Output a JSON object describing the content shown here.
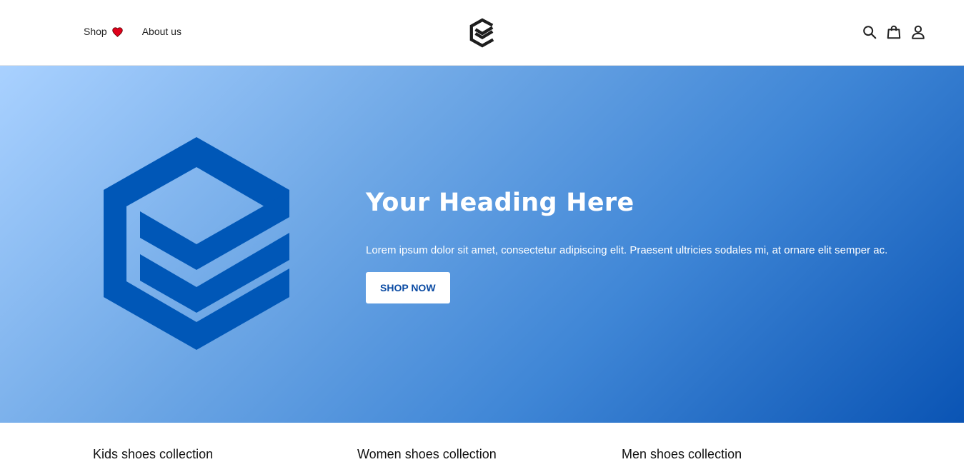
{
  "header": {
    "nav_left": [
      {
        "label": "Shop",
        "icon": "heart-icon"
      },
      {
        "label": "About us"
      }
    ],
    "logo": "brand-logo-icon",
    "nav_right_icons": [
      "search-icon",
      "shopping-bag-icon",
      "user-icon"
    ]
  },
  "hero": {
    "heading": "Your Heading Here",
    "text": "Lorem ipsum dolor sit amet, consectetur adipiscing elit. Praesent ultricies sodales mi, at ornare elit semper ac.",
    "button_label": "SHOP NOW",
    "graphic": "brand-logo-icon"
  },
  "collections": [
    {
      "title": "Kids shoes collection"
    },
    {
      "title": "Women shoes collection"
    },
    {
      "title": "Men shoes collection"
    }
  ],
  "colors": {
    "hero_gradient_start": "#a9d1ff",
    "hero_gradient_end": "#0a54b4",
    "brand_blue": "#0057b7",
    "button_text": "#0b4ba3",
    "heart_red": "#e0001b"
  }
}
